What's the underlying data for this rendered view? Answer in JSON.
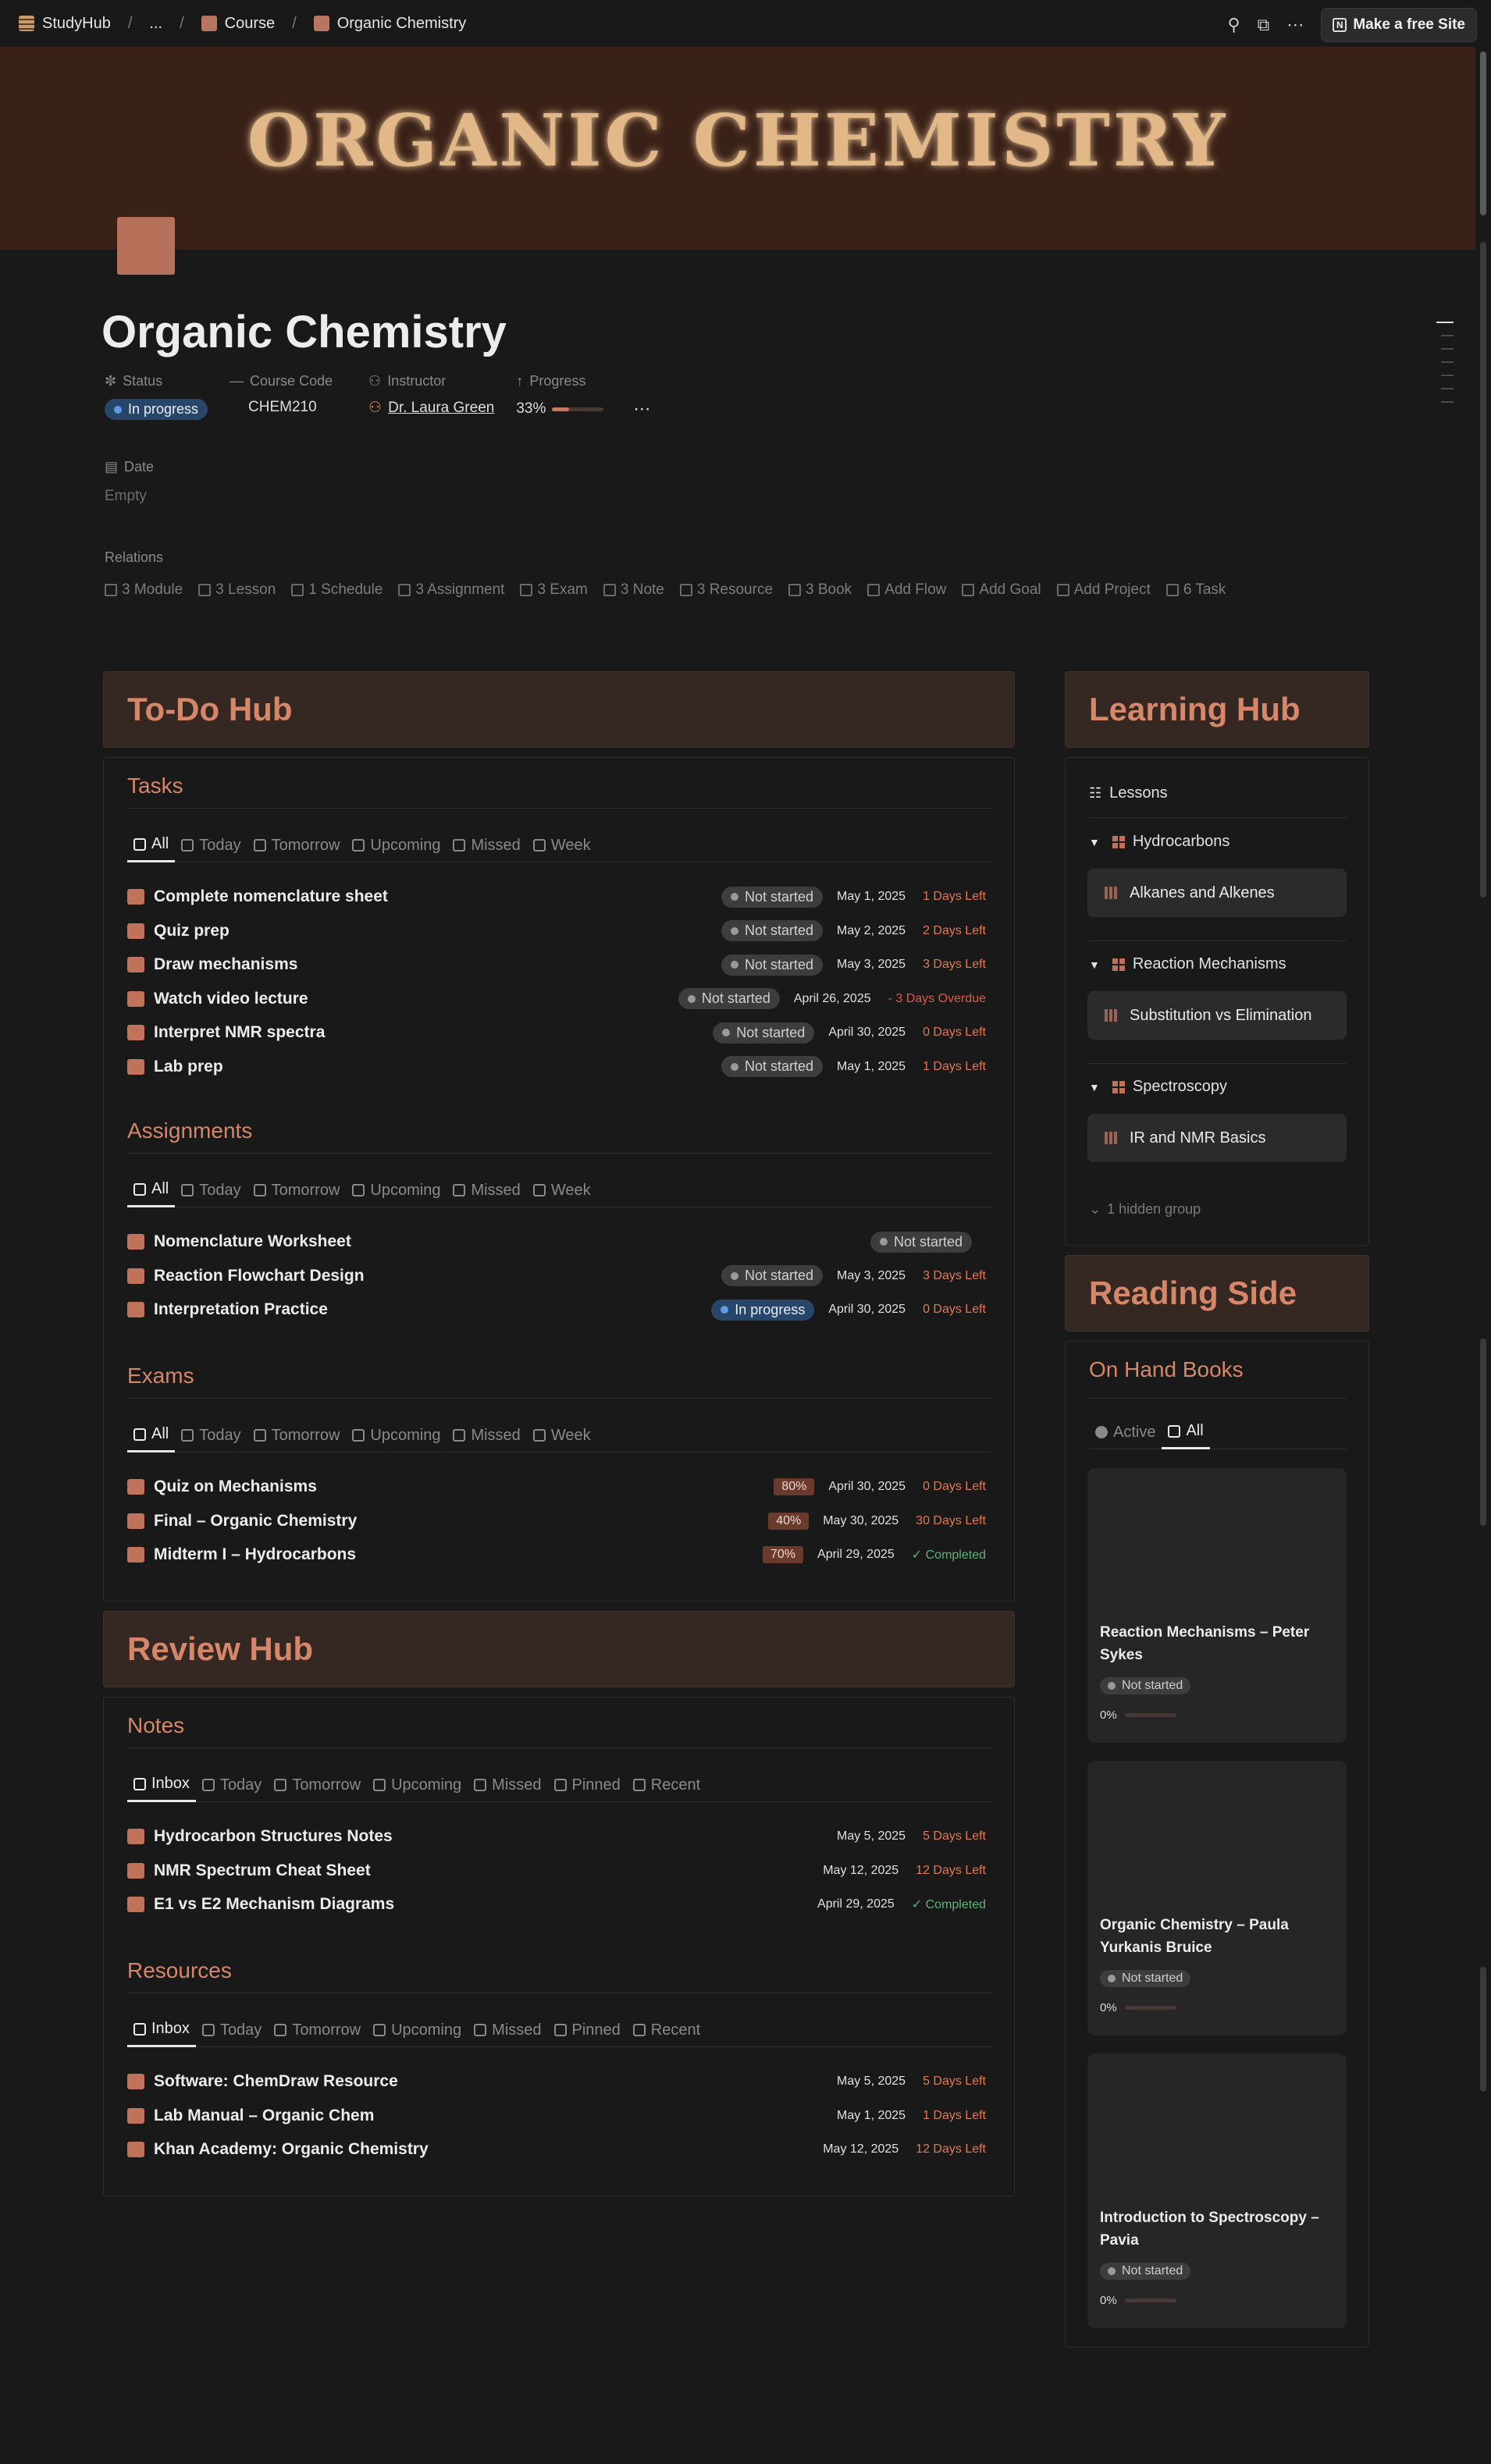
{
  "breadcrumb": {
    "workspace": "StudyHub",
    "ellipsis": "...",
    "parent": "Course",
    "current": "Organic Chemistry"
  },
  "topbar": {
    "make_site": "Make a free Site"
  },
  "banner": {
    "title": "ORGANIC CHEMISTRY"
  },
  "page": {
    "title": "Organic Chemistry"
  },
  "properties": {
    "status": {
      "label": "Status",
      "value": "In progress"
    },
    "course_code": {
      "label": "Course Code",
      "value": "CHEM210"
    },
    "instructor": {
      "label": "Instructor",
      "value": "Dr. Laura Green"
    },
    "progress": {
      "label": "Progress",
      "value": "33%",
      "fraction": 0.33
    },
    "date": {
      "label": "Date",
      "value": "Empty"
    }
  },
  "relations": {
    "label": "Relations",
    "items": [
      "3 Module",
      "3 Lesson",
      "1 Schedule",
      "3 Assignment",
      "3 Exam",
      "3 Note",
      "3 Resource",
      "3 Book",
      "Add Flow",
      "Add Goal",
      "Add Project",
      "6 Task"
    ]
  },
  "todo_hub": {
    "title": "To-Do Hub",
    "tasks": {
      "title": "Tasks",
      "tabs": [
        "All",
        "Today",
        "Tomorrow",
        "Upcoming",
        "Missed",
        "Week"
      ],
      "rows": [
        {
          "name": "Complete nomenclature sheet",
          "status": "Not started",
          "date": "May 1, 2025",
          "left": "1 Days Left"
        },
        {
          "name": "Quiz prep",
          "status": "Not started",
          "date": "May 2, 2025",
          "left": "2 Days Left"
        },
        {
          "name": "Draw mechanisms",
          "status": "Not started",
          "date": "May 3, 2025",
          "left": "3 Days Left"
        },
        {
          "name": "Watch video lecture",
          "status": "Not started",
          "date": "April 26, 2025",
          "left": "- 3 Days Overdue"
        },
        {
          "name": "Interpret NMR spectra",
          "status": "Not started",
          "date": "April 30, 2025",
          "left": "0 Days Left"
        },
        {
          "name": "Lab prep",
          "status": "Not started",
          "date": "May 1, 2025",
          "left": "1 Days Left"
        }
      ]
    },
    "assignments": {
      "title": "Assignments",
      "tabs": [
        "All",
        "Today",
        "Tomorrow",
        "Upcoming",
        "Missed",
        "Week"
      ],
      "rows": [
        {
          "name": "Nomenclature Worksheet",
          "status": "Not started",
          "date": "",
          "left": ""
        },
        {
          "name": "Reaction Flowchart Design",
          "status": "Not started",
          "date": "May 3, 2025",
          "left": "3 Days Left"
        },
        {
          "name": "Interpretation Practice",
          "status": "In progress",
          "date": "April 30, 2025",
          "left": "0 Days Left"
        }
      ]
    },
    "exams": {
      "title": "Exams",
      "tabs": [
        "All",
        "Today",
        "Tomorrow",
        "Upcoming",
        "Missed",
        "Week"
      ],
      "rows": [
        {
          "name": "Quiz on Mechanisms",
          "score": "80%",
          "date": "April 30, 2025",
          "left": "0 Days Left"
        },
        {
          "name": "Final – Organic Chemistry",
          "score": "40%",
          "date": "May 30, 2025",
          "left": "30 Days Left"
        },
        {
          "name": "Midterm I – Hydrocarbons",
          "score": "70%",
          "date": "April 29, 2025",
          "left": "✓ Completed"
        }
      ]
    }
  },
  "review_hub": {
    "title": "Review Hub",
    "notes": {
      "title": "Notes",
      "tabs": [
        "Inbox",
        "Today",
        "Tomorrow",
        "Upcoming",
        "Missed",
        "Pinned",
        "Recent"
      ],
      "rows": [
        {
          "name": "Hydrocarbon Structures Notes",
          "date": "May 5, 2025",
          "left": "5 Days Left"
        },
        {
          "name": "NMR Spectrum Cheat Sheet",
          "date": "May 12, 2025",
          "left": "12 Days Left"
        },
        {
          "name": "E1 vs E2 Mechanism Diagrams",
          "date": "April 29, 2025",
          "left": "✓ Completed"
        }
      ]
    },
    "resources": {
      "title": "Resources",
      "tabs": [
        "Inbox",
        "Today",
        "Tomorrow",
        "Upcoming",
        "Missed",
        "Pinned",
        "Recent"
      ],
      "rows": [
        {
          "name": "Software: ChemDraw Resource",
          "date": "May 5, 2025",
          "left": "5 Days Left"
        },
        {
          "name": "Lab Manual – Organic Chem",
          "date": "May 1, 2025",
          "left": "1 Days Left"
        },
        {
          "name": "Khan Academy: Organic Chemistry",
          "date": "May 12, 2025",
          "left": "12 Days Left"
        }
      ]
    }
  },
  "learning_hub": {
    "title": "Learning Hub",
    "lessons_label": "Lessons",
    "groups": [
      {
        "name": "Hydrocarbons",
        "lesson": "Alkanes and Alkenes"
      },
      {
        "name": "Reaction Mechanisms",
        "lesson": "Substitution vs Elimination"
      },
      {
        "name": "Spectroscopy",
        "lesson": "IR and NMR Basics"
      }
    ],
    "hidden": "1 hidden group"
  },
  "reading_side": {
    "title": "Reading Side",
    "books_title": "On Hand Books",
    "tabs": [
      "Active",
      "All"
    ],
    "books": [
      {
        "title": "Reaction Mechanisms – Peter Sykes",
        "status": "Not started",
        "progress": "0%"
      },
      {
        "title": "Organic Chemistry – Paula Yurkanis Bruice",
        "status": "Not started",
        "progress": "0%"
      },
      {
        "title": "Introduction to Spectroscopy – Pavia",
        "status": "Not started",
        "progress": "0%"
      }
    ]
  },
  "colors": {
    "accent": "#d6876a",
    "banner": "#3a2117",
    "background": "#191919",
    "overdue": "#e05a47",
    "completed": "#5fb27a"
  }
}
